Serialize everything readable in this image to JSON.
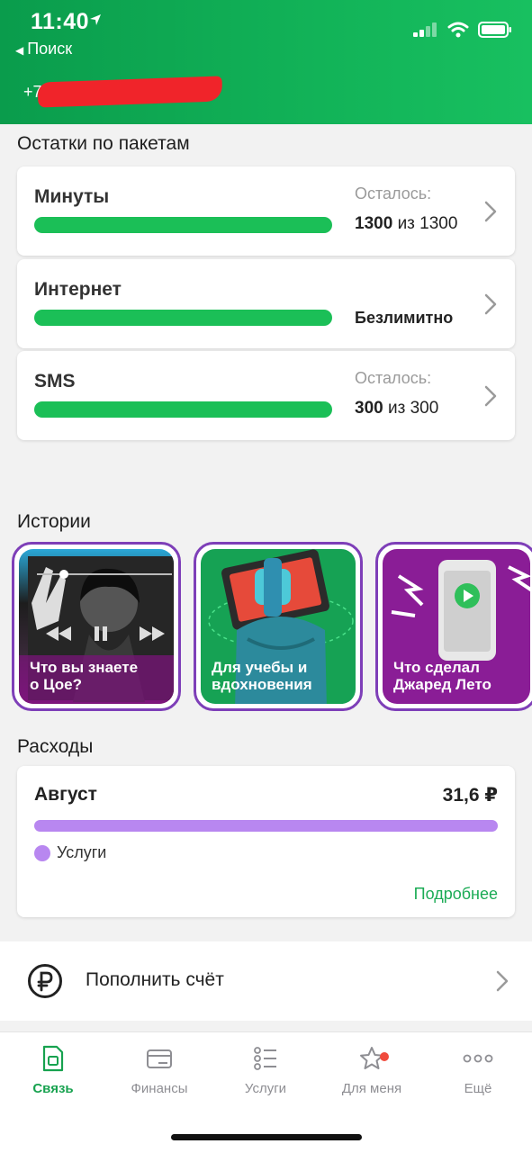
{
  "status_bar": {
    "time": "11:40",
    "back_label": "Поиск"
  },
  "header": {
    "phone_visible": "+7 9"
  },
  "packages": {
    "title": "Остатки по пакетам",
    "items": [
      {
        "name": "Минуты",
        "remain_label": "Осталось:",
        "remain_value": "1300",
        "remain_of": "из 1300",
        "progress": 1.0
      },
      {
        "name": "Интернет",
        "remain_label": "",
        "remain_value": "Безлимитно",
        "remain_of": "",
        "progress": 1.0
      },
      {
        "name": "SMS",
        "remain_label": "Осталось:",
        "remain_value": "300",
        "remain_of": "из 300",
        "progress": 1.0
      }
    ]
  },
  "stories": {
    "title": "Истории",
    "items": [
      {
        "line1": "Что вы знаете",
        "line2": "о Цое?"
      },
      {
        "line1": "Для учебы и",
        "line2": "вдохновения"
      },
      {
        "line1": "Что сделал",
        "line2": "Джаред Лето"
      }
    ]
  },
  "expenses": {
    "title": "Расходы",
    "month": "Август",
    "amount": "31,6 ₽",
    "legend": "Услуги",
    "more": "Подробнее",
    "accent": "#b887f0"
  },
  "topup": {
    "label": "Пополнить счёт",
    "icon": "ruble-icon"
  },
  "tabbar": {
    "items": [
      {
        "label": "Связь",
        "icon": "sim-icon",
        "active": true
      },
      {
        "label": "Финансы",
        "icon": "card-icon",
        "active": false
      },
      {
        "label": "Услуги",
        "icon": "list-icon",
        "active": false
      },
      {
        "label": "Для меня",
        "icon": "star-icon",
        "active": false,
        "badge": true
      },
      {
        "label": "Ещё",
        "icon": "more-icon",
        "active": false
      }
    ]
  },
  "colors": {
    "brand_green": "#1bbf57",
    "header_green": "#0a9c4c",
    "story_border": "#7e3fb8"
  }
}
